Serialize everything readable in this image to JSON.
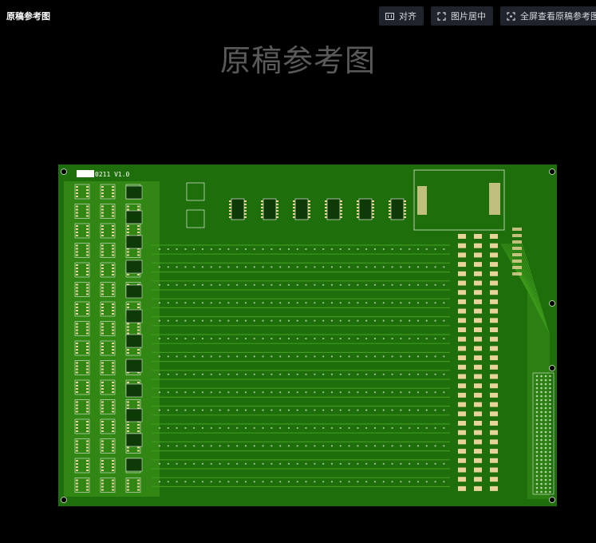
{
  "app": {
    "title": "原稿参考图"
  },
  "toolbar": {
    "align_label": "对齐",
    "center_label": "图片居中",
    "fullscreen_label": "全屏查看原稿参考图"
  },
  "canvas": {
    "watermark": "原稿参考图"
  },
  "board": {
    "silkscreen_label": "0211 V1.0",
    "colors": {
      "substrate": "#1f6e0c",
      "copper": "#3f9a1c",
      "pad": "#e8d39a",
      "silk": "#ffffff",
      "ink": "#000000"
    }
  }
}
